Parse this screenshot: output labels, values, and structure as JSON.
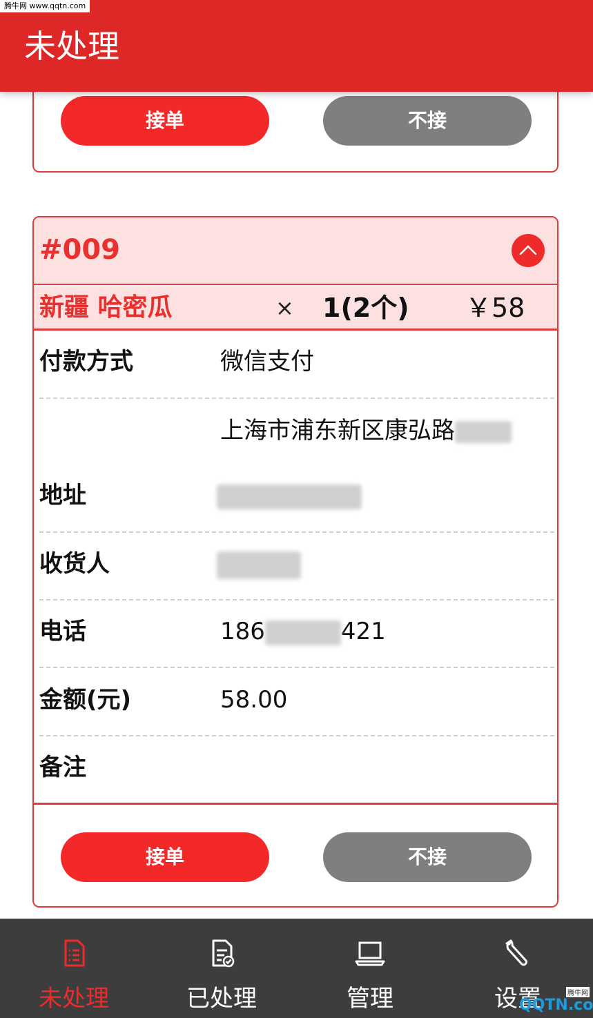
{
  "watermark": {
    "top": "腾牛网 www.qqtn.com",
    "bottom_brand": "QQTN",
    "bottom_suffix": ".com",
    "bottom_small": "腾牛网"
  },
  "header": {
    "title": "未处理"
  },
  "top_card": {
    "accept_label": "接单",
    "reject_label": "不接"
  },
  "order": {
    "number": "#009",
    "item": {
      "name": "新疆 哈密瓜",
      "times": "×",
      "quantity": "1(2个)",
      "price": "￥58"
    },
    "fields": [
      {
        "label": "付款方式",
        "value": "微信支付"
      },
      {
        "label": "地址",
        "value_line1": "上海市浦东新区康弘路",
        "value_line2": ""
      },
      {
        "label": "收货人",
        "value": ""
      },
      {
        "label": "电话",
        "value_prefix": "186",
        "value_suffix": "421"
      },
      {
        "label": "金额(元)",
        "value": "58.00"
      },
      {
        "label": "备注",
        "value": ""
      }
    ],
    "accept_label": "接单",
    "reject_label": "不接"
  },
  "nav": {
    "items": [
      {
        "label": "未处理",
        "icon": "document-list-icon",
        "active": true
      },
      {
        "label": "已处理",
        "icon": "document-check-icon",
        "active": false
      },
      {
        "label": "管理",
        "icon": "laptop-icon",
        "active": false
      },
      {
        "label": "设置",
        "icon": "wrench-icon",
        "active": false
      }
    ]
  },
  "colors": {
    "primary": "#de2827",
    "accent": "#f32929",
    "grey_button": "#7f7f7f",
    "highlight_bg": "#fde0e0",
    "nav_bg": "#3d3d3d"
  }
}
